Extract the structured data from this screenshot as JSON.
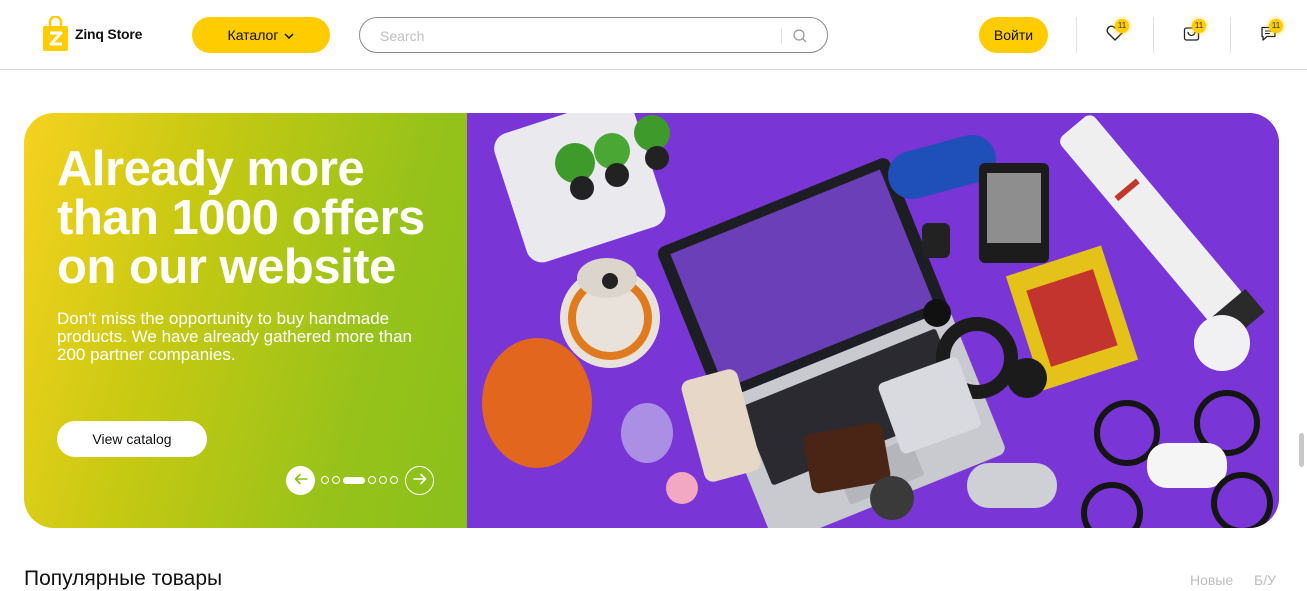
{
  "header": {
    "logo_text": "Zinq Store",
    "catalog_label": "Каталог",
    "search_placeholder": "Search",
    "login_label": "Войти",
    "favorites_count": "11",
    "cart_count": "11",
    "messages_count": "11"
  },
  "banner": {
    "title": "Already more than 1000 offers on our website",
    "subtitle": "Don't miss the opportunity to buy handmade products. We have already gathered more than 200 partner companies.",
    "cta_label": "View catalog",
    "slide_count": 6,
    "active_slide": 3
  },
  "products": {
    "title": "Популярные товары",
    "filters": [
      "Новые",
      "Б/У"
    ]
  },
  "colors": {
    "accent": "#ffcc00",
    "banner_gradient_start": "#f6d21f",
    "banner_gradient_end": "#8bc01c",
    "photo_background": "#7a35d6"
  }
}
